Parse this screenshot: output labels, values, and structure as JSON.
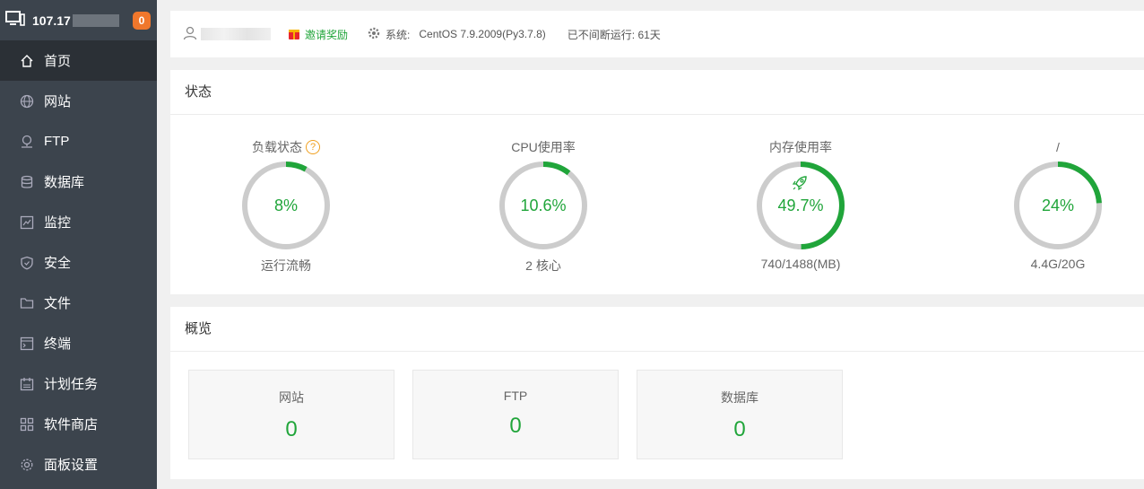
{
  "sidebar": {
    "host": "107.17",
    "notification_count": "0",
    "items": [
      {
        "label": "首页",
        "icon": "home-icon"
      },
      {
        "label": "网站",
        "icon": "globe-icon"
      },
      {
        "label": "FTP",
        "icon": "ftp-icon"
      },
      {
        "label": "数据库",
        "icon": "database-icon"
      },
      {
        "label": "监控",
        "icon": "monitor-icon"
      },
      {
        "label": "安全",
        "icon": "shield-icon"
      },
      {
        "label": "文件",
        "icon": "folder-icon"
      },
      {
        "label": "终端",
        "icon": "terminal-icon"
      },
      {
        "label": "计划任务",
        "icon": "calendar-icon"
      },
      {
        "label": "软件商店",
        "icon": "grid-icon"
      },
      {
        "label": "面板设置",
        "icon": "gear-icon"
      }
    ]
  },
  "topbar": {
    "invite_label": "邀请奖励",
    "system_label": "系统:",
    "system_value": "CentOS 7.9.2009(Py3.7.8)",
    "uptime": "已不间断运行: 61天"
  },
  "status": {
    "title": "状态",
    "gauges": [
      {
        "title": "负载状态",
        "value": "8%",
        "percent": 8,
        "sub": "运行流畅"
      },
      {
        "title": "CPU使用率",
        "value": "10.6%",
        "percent": 10.6,
        "sub": "2 核心"
      },
      {
        "title": "内存使用率",
        "value": "49.7%",
        "percent": 49.7,
        "sub": "740/1488(MB)"
      },
      {
        "title": "/",
        "value": "24%",
        "percent": 24,
        "sub": "4.4G/20G"
      }
    ]
  },
  "overview": {
    "title": "概览",
    "cards": [
      {
        "label": "网站",
        "value": "0"
      },
      {
        "label": "FTP",
        "value": "0"
      },
      {
        "label": "数据库",
        "value": "0"
      }
    ]
  },
  "colors": {
    "accent": "#20a53a",
    "sidebar_bg": "#3c444d",
    "sidebar_active": "#2b3036",
    "badge": "#f0772c",
    "ring_track": "#cccccc"
  }
}
